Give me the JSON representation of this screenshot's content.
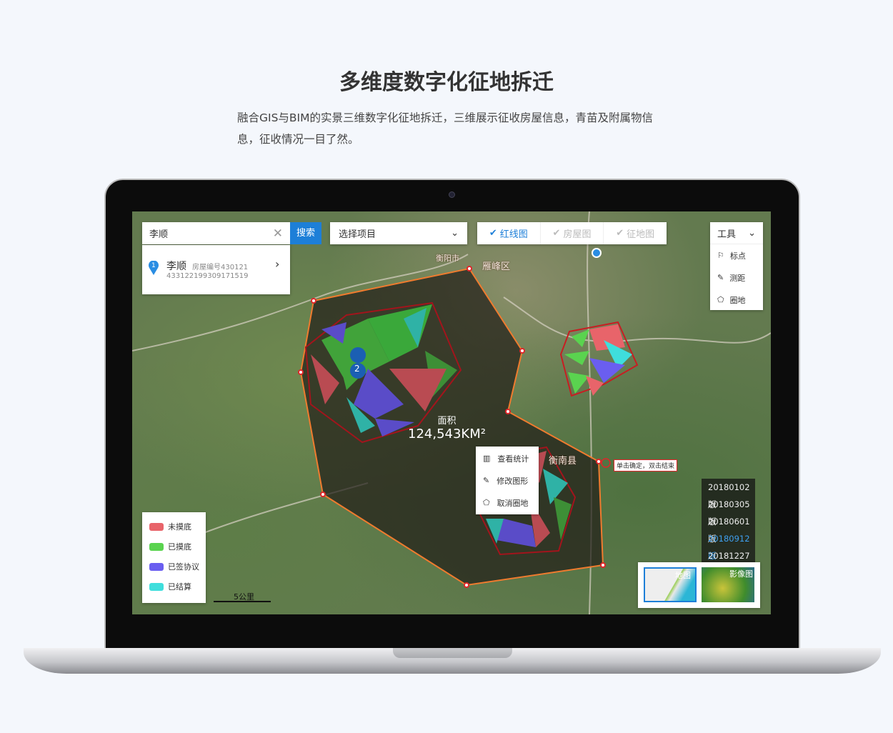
{
  "heading": "多维度数字化征地拆迁",
  "description": "融合GIS与BIM的实景三维数字化征地拆迁，三维展示征收房屋信息，青苗及附属物信息，征收情况一目了然。",
  "app": {
    "search": {
      "value": "李顺",
      "button": "搜索"
    },
    "result": {
      "index": "1",
      "name": "李顺",
      "house_no": "房屋编号430121",
      "id_no": "433122199309171519"
    },
    "project_select": {
      "value": "选择项目"
    },
    "layers": [
      {
        "label": "红线图",
        "checked": true
      },
      {
        "label": "房屋图",
        "checked": false
      },
      {
        "label": "征地图",
        "checked": false
      }
    ],
    "tools": {
      "label": "工具",
      "items": [
        "标点",
        "测距",
        "圈地"
      ]
    },
    "map_labels": [
      "衡阳市",
      "雁峰区",
      "衡南县"
    ],
    "marker": "2",
    "area": {
      "label": "面积",
      "value": "124,543KM²"
    },
    "context_menu": [
      "查看统计",
      "修改图形",
      "取消圈地"
    ],
    "hint": "单击确定，双击结束",
    "versions": [
      "20180102版",
      "20180305版",
      "20180601版",
      "20180912版",
      "20181227版"
    ],
    "active_version": "20180912版",
    "basemaps": [
      "地图",
      "影像图"
    ],
    "legend": [
      {
        "label": "未摸底",
        "color": "#e8646a"
      },
      {
        "label": "已摸底",
        "color": "#5ad34f"
      },
      {
        "label": "已签协议",
        "color": "#6a5ef0"
      },
      {
        "label": "已结算",
        "color": "#3fdedc"
      }
    ],
    "scale": "5公里",
    "accent": "#1d7fd8"
  }
}
